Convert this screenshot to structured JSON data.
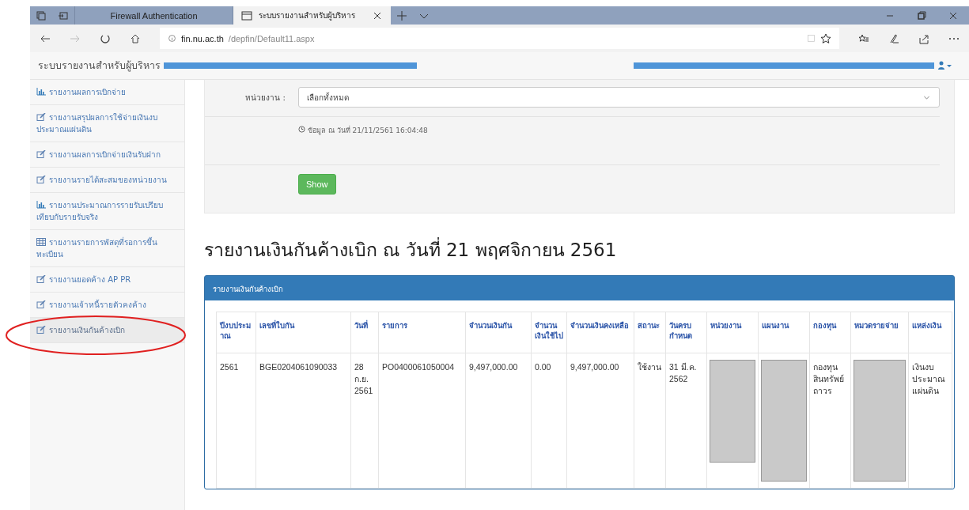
{
  "browser": {
    "tabs": [
      {
        "label": "Firewall Authentication",
        "selected": false
      },
      {
        "label": "ระบบรายงานสำหรับผู้บริหาร",
        "selected": true
      }
    ],
    "url": {
      "host": "fin.nu.ac.th",
      "path": "/depfin/Default11.aspx"
    }
  },
  "header": {
    "title": "ระบบรายงานสำหรับผู้บริหาร"
  },
  "sidebar": {
    "items": [
      {
        "label": "รายงานผลการเบิกจ่าย",
        "kind": "chart",
        "selected": false
      },
      {
        "label": "รายงานสรุปผลการใช้จ่ายเงินงบประมาณแผ่นดิน",
        "kind": "edit",
        "selected": false
      },
      {
        "label": "รายงานผลการเบิกจ่ายเงินรับฝาก",
        "kind": "edit",
        "selected": false
      },
      {
        "label": "รายงานรายได้สะสมของหน่วยงาน",
        "kind": "edit",
        "selected": false
      },
      {
        "label": "รายงานประมาณการรายรับเปรียบเทียบกับรายรับจริง",
        "kind": "chart",
        "selected": false
      },
      {
        "label": "รายงานรายการพัสดุที่รอการขึ้นทะเบียน",
        "kind": "table",
        "selected": false
      },
      {
        "label": "รายงานยอดค้าง AP PR",
        "kind": "edit",
        "selected": false
      },
      {
        "label": "รายงานเจ้าหนี้รายตัวคงค้าง",
        "kind": "edit",
        "selected": false
      },
      {
        "label": "รายงานเงินกันค้างเบิก",
        "kind": "edit",
        "selected": true
      }
    ]
  },
  "form": {
    "label": "หน่วยงาน :",
    "select": "เลือกทั้งหมด",
    "timestamp": "ข้อมูล ณ วันที่ 21/11/2561 16:04:48",
    "button": "Show"
  },
  "report": {
    "heading": "รายงานเงินกันค้างเบิก ณ วันที่ 21 พฤศจิกายน 2561",
    "panel_title": "รายงานเงินกันค้างเบิก",
    "table": {
      "columns": [
        "ปีงบประมาณ",
        "เลขที่ใบกัน",
        "วันที่",
        "รายการ",
        "จำนวนเงินกัน",
        "จำนวนเงินใช้ไป",
        "จำนวนเงินคงเหลือ",
        "สถานะ",
        "วันครบกำหนด",
        "หน่วยงาน",
        "แผนงาน",
        "กองทุน",
        "หมวดรายจ่าย",
        "แหล่งเงิน"
      ],
      "rows": [
        {
          "cells": [
            {
              "text": "2561"
            },
            {
              "text": "BGE0204061090033"
            },
            {
              "text": "28 ก.ย. 2561"
            },
            {
              "text": "PO0400061050004"
            },
            {
              "text": "9,497,000.00"
            },
            {
              "text": "0.00"
            },
            {
              "text": "9,497,000.00"
            },
            {
              "text": "ใช้งาน"
            },
            {
              "text": "31 มี.ค. 2562"
            },
            {
              "redacted": true
            },
            {
              "redacted": true
            },
            {
              "text": "กองทุนสินทรัพย์ถาวร"
            },
            {
              "redacted": true
            },
            {
              "text": "เงินงบประมาณแผ่นดิน"
            }
          ]
        }
      ]
    }
  }
}
